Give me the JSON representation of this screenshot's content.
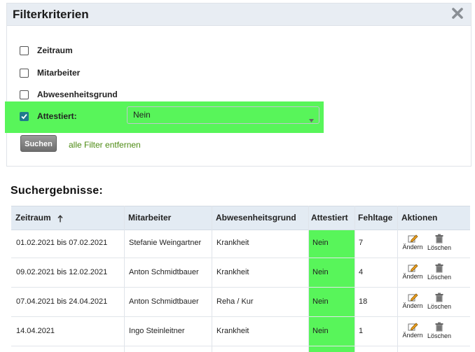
{
  "filter": {
    "title": "Filterkriterien",
    "options": [
      {
        "label": "Zeitraum",
        "checked": false
      },
      {
        "label": "Mitarbeiter",
        "checked": false
      },
      {
        "label": "Abwesenheitsgrund",
        "checked": false
      },
      {
        "label": "Attestiert:",
        "checked": true
      }
    ],
    "attestiert_select": {
      "value": "Nein"
    },
    "search_button": "Suchen",
    "clear_link": "alle Filter entfernen"
  },
  "results": {
    "title": "Suchergebnisse:",
    "columns": [
      "Zeitraum",
      "Mitarbeiter",
      "Abwesenheitsgrund",
      "Attestiert",
      "Fehltage",
      "Aktionen"
    ],
    "sort_indicator": "↑",
    "rows": [
      {
        "zeitraum": "01.02.2021 bis 07.02.2021",
        "mitarbeiter": "Stefanie Weingartner",
        "grund": "Krankheit",
        "attestiert": "Nein",
        "fehltage": "7"
      },
      {
        "zeitraum": "09.02.2021 bis 12.02.2021",
        "mitarbeiter": "Anton Schmidtbauer",
        "grund": "Krankheit",
        "attestiert": "Nein",
        "fehltage": "4"
      },
      {
        "zeitraum": "07.04.2021 bis 24.04.2021",
        "mitarbeiter": "Anton Schmidtbauer",
        "grund": "Reha / Kur",
        "attestiert": "Nein",
        "fehltage": "18"
      },
      {
        "zeitraum": "14.04.2021",
        "mitarbeiter": "Ingo Steinleitner",
        "grund": "Krankheit",
        "attestiert": "Nein",
        "fehltage": "1"
      }
    ],
    "actions": {
      "edit": "Ändern",
      "delete": "Löschen"
    }
  },
  "colors": {
    "highlight": "#58f55a",
    "header_bg": "#e8edf3",
    "link": "#4c8a12",
    "checkbox": "#1f7a8c"
  },
  "icons": {
    "close": "close-icon",
    "sort": "arrow-up-icon",
    "edit": "edit-icon",
    "delete": "trash-icon"
  }
}
